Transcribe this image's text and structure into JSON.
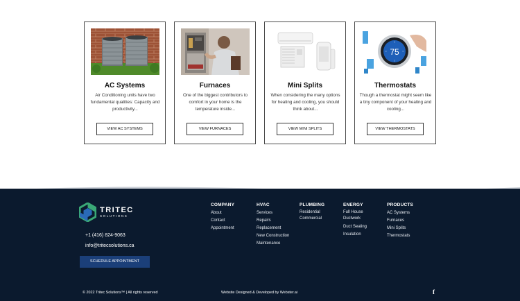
{
  "cards": [
    {
      "title": "AC Systems",
      "description": "Air Conditioning units have two fundamental qualities: Capacity and productivity...",
      "button": "VIEW AC SYSTEMS"
    },
    {
      "title": "Furnaces",
      "description": "One of the biggest contributors to comfort in your home is the temperature inside...",
      "button": "VIEW FURNACES"
    },
    {
      "title": "Mini Splits",
      "description": "When considering the many options for heating and cooling, you should think about...",
      "button": "VIEW MINI SPLITS"
    },
    {
      "title": "Thermostats",
      "description": "Though a thermostat might seem like a tiny component of your heating and cooling...",
      "button": "VIEW THERMOSTATS",
      "thermostat_reading": "75"
    }
  ],
  "footer": {
    "logo_main": "TRITEC",
    "logo_sub": "SOLUTIONS",
    "phone": "+1 (416) 824-9063",
    "email": "info@tritecsolutions.ca",
    "schedule_button": "SCHEDULE APPOINTMENT",
    "columns": [
      {
        "heading": "COMPANY",
        "items": [
          "About",
          "Contact",
          "Appointment"
        ]
      },
      {
        "heading": "HVAC",
        "items": [
          "Services",
          "Repairs",
          "Replacement",
          "New Construction",
          "Maintenance"
        ]
      },
      {
        "heading": "PLUMBING",
        "items": [
          "Residential",
          "Commercial"
        ]
      },
      {
        "heading": "ENERGY",
        "items": [
          "Full House Ductwork",
          "Duct Sealing",
          "Insulation"
        ]
      },
      {
        "heading": "PRODUCTS",
        "items": [
          "AC Systems",
          "Furnaces",
          "Mini Splits",
          "Thermostats"
        ]
      }
    ],
    "copyright": "© 2022 Tritec Solutions™ | All rights reserved",
    "credit": "Website Designed & Developed by Webster.ai",
    "social_icon": "facebook-icon"
  },
  "colors": {
    "footer_bg": "#0b1a2e",
    "button_blue": "#1b3f79",
    "logo_green": "#3aa876",
    "logo_blue": "#2a6ab8"
  }
}
